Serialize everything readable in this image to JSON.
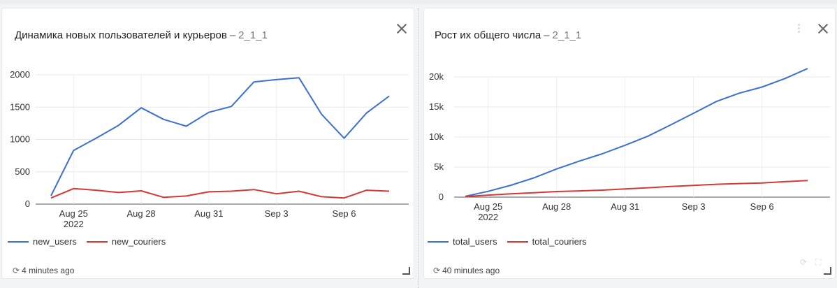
{
  "cards": [
    {
      "title": "Динамика новых пользователей и курьеров",
      "separator": "–",
      "subtitle": "2_1_1",
      "updated": "4 minutes ago",
      "legend": [
        {
          "label": "new_users",
          "color": "#3b6fd4"
        },
        {
          "label": "new_couriers",
          "color": "#d23a35"
        }
      ],
      "chart_data": {
        "type": "line",
        "x_ticks": [
          "Aug 25",
          "Aug 28",
          "Aug 31",
          "Sep 3",
          "Sep 6"
        ],
        "x_year_label": "2022",
        "x": [
          "2022-08-24",
          "2022-08-25",
          "2022-08-26",
          "2022-08-27",
          "2022-08-28",
          "2022-08-29",
          "2022-08-30",
          "2022-08-31",
          "2022-09-01",
          "2022-09-02",
          "2022-09-03",
          "2022-09-04",
          "2022-09-05",
          "2022-09-06",
          "2022-09-07",
          "2022-09-08"
        ],
        "ylim": [
          0,
          2000
        ],
        "y_ticks": [
          0,
          500,
          1000,
          1500,
          2000
        ],
        "y_tick_labels": [
          "0",
          "500",
          "1000",
          "1500",
          "2000"
        ],
        "grid": true,
        "series": [
          {
            "name": "new_users",
            "color": "#3b6fd4",
            "values": [
              130,
              830,
              1020,
              1220,
              1490,
              1310,
              1205,
              1420,
              1510,
              1890,
              1925,
              1955,
              1390,
              1020,
              1410,
              1670
            ]
          },
          {
            "name": "new_couriers",
            "color": "#d23a35",
            "values": [
              95,
              240,
              215,
              180,
              205,
              105,
              125,
              190,
              200,
              225,
              160,
              200,
              115,
              95,
              215,
              200
            ]
          }
        ]
      }
    },
    {
      "title": "Рост их общего числа",
      "separator": "–",
      "subtitle": "2_1_1",
      "updated": "40 minutes ago",
      "legend": [
        {
          "label": "total_users",
          "color": "#3b6fd4"
        },
        {
          "label": "total_couriers",
          "color": "#d23a35"
        }
      ],
      "chart_data": {
        "type": "line",
        "x_ticks": [
          "Aug 25",
          "Aug 28",
          "Aug 31",
          "Sep 3",
          "Sep 6"
        ],
        "x_year_label": "2022",
        "x": [
          "2022-08-24",
          "2022-08-25",
          "2022-08-26",
          "2022-08-27",
          "2022-08-28",
          "2022-08-29",
          "2022-08-30",
          "2022-08-31",
          "2022-09-01",
          "2022-09-02",
          "2022-09-03",
          "2022-09-04",
          "2022-09-05",
          "2022-09-06",
          "2022-09-07",
          "2022-09-08"
        ],
        "ylim": [
          0,
          22500
        ],
        "y_ticks": [
          0,
          5000,
          10000,
          15000,
          20000
        ],
        "y_tick_labels": [
          "0",
          "5k",
          "10k",
          "15k",
          "20k"
        ],
        "grid": true,
        "series": [
          {
            "name": "total_users",
            "color": "#3b6fd4",
            "values": [
              130,
              960,
              1980,
              3200,
              4690,
              6000,
              7205,
              8625,
              10135,
              12025,
              13950,
              15905,
              17295,
              18315,
              19725,
              21395
            ]
          },
          {
            "name": "total_couriers",
            "color": "#d23a35",
            "values": [
              95,
              335,
              550,
              730,
              935,
              1040,
              1165,
              1355,
              1555,
              1780,
              1940,
              2140,
              2255,
              2350,
              2565,
              2765
            ]
          }
        ]
      }
    }
  ]
}
